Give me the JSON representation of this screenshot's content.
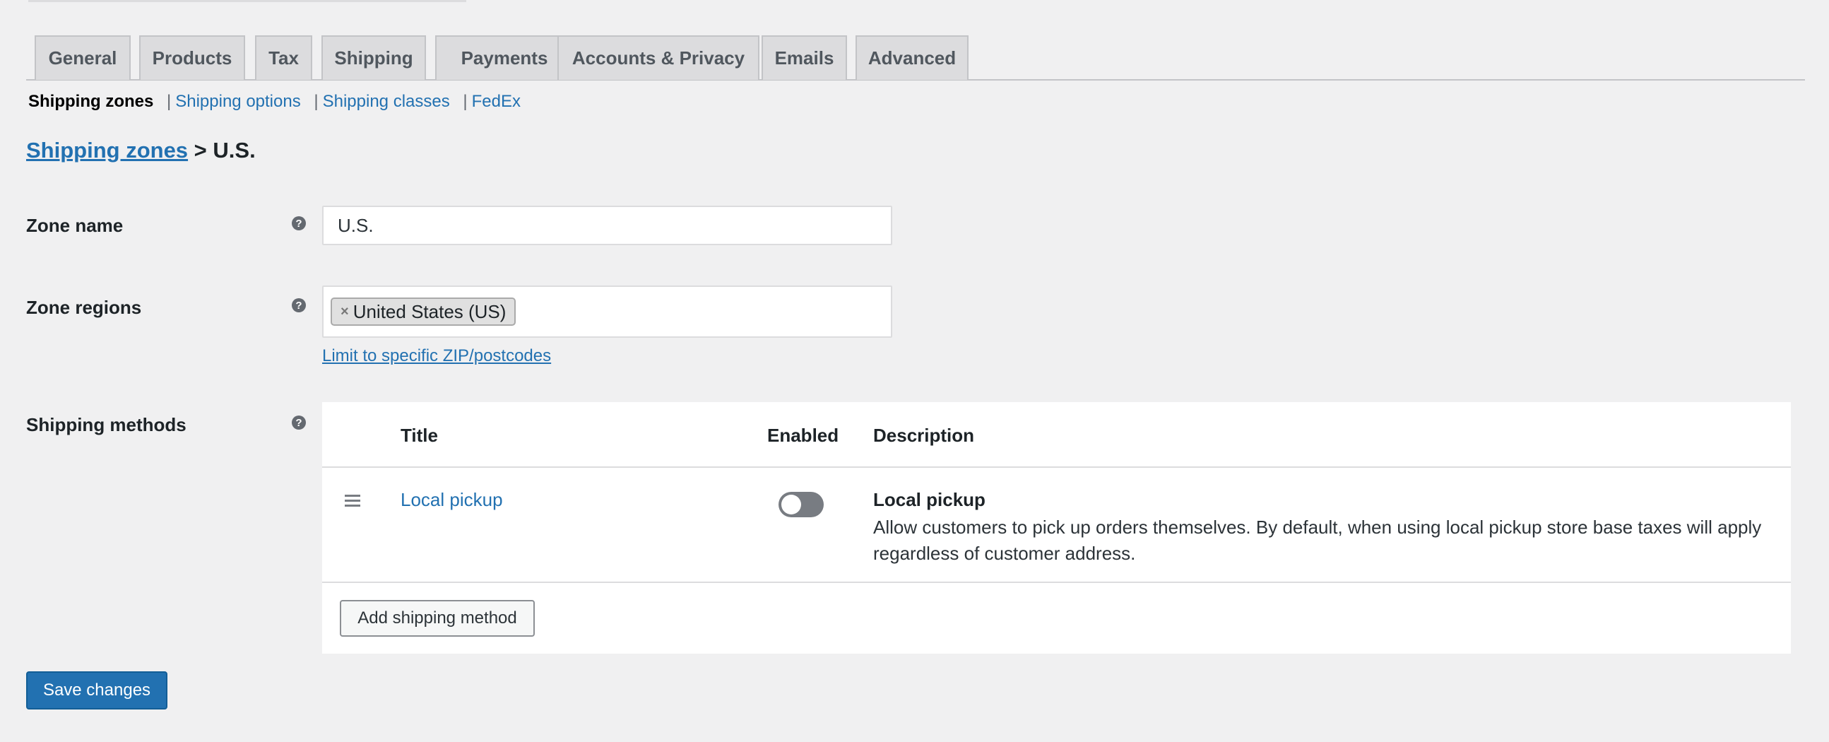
{
  "tabs": [
    "General",
    "Products",
    "Tax",
    "Shipping",
    "Payments",
    "Accounts & Privacy",
    "Emails",
    "Advanced"
  ],
  "active_tab": "Shipping",
  "subnav": {
    "current": "Shipping zones",
    "links": [
      "Shipping options",
      "Shipping classes",
      "FedEx"
    ],
    "separator": "|"
  },
  "heading": {
    "link": "Shipping zones",
    "rest": " > U.S."
  },
  "zone_name": {
    "label": "Zone name",
    "value": "U.S."
  },
  "zone_regions": {
    "label": "Zone regions",
    "chip": "United States (US)",
    "chip_remove": "×",
    "limit_link": "Limit to specific ZIP/postcodes"
  },
  "help_glyph": "?",
  "shipping_methods": {
    "label": "Shipping methods",
    "columns": {
      "title": "Title",
      "enabled": "Enabled",
      "description": "Description"
    },
    "rows": [
      {
        "title": "Local pickup",
        "enabled": false,
        "desc_title": "Local pickup",
        "desc_text": "Allow customers to pick up orders themselves. By default, when using local pickup store base taxes will apply regardless of customer address."
      }
    ],
    "add_button": "Add shipping method"
  },
  "save_button": "Save changes",
  "colors": {
    "accent": "#2271b1",
    "background": "#f0f0f1",
    "toggle_off": "#787c82"
  }
}
